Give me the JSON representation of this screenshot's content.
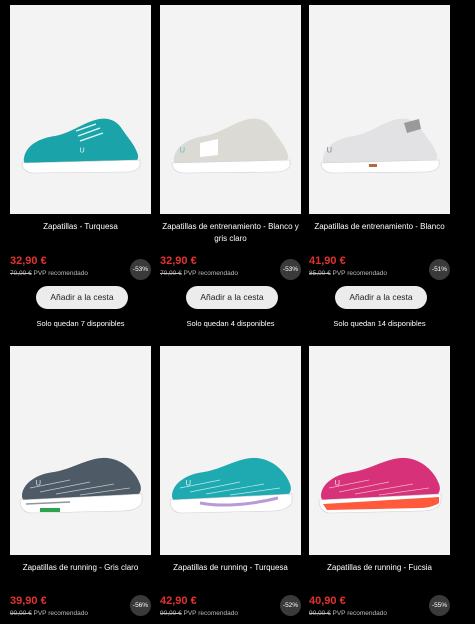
{
  "colors": {
    "background": "#000000",
    "price": "#e4322f",
    "image_bg": "#f3f3f3",
    "button_bg": "#ececec"
  },
  "products": [
    {
      "name": "Zapatillas - Turquesa",
      "price": "32,90 €",
      "old_price": "70,00 €",
      "pvp_label": "PVP recomendado",
      "discount": "-53%",
      "cart_label": "Añadir a la cesta",
      "stock": "Solo quedan 7 disponibles",
      "shoe_color": "#1aa3a8",
      "shoe_style": "trainer"
    },
    {
      "name": "Zapatillas de entrenamiento - Blanco y gris claro",
      "price": "32,90 €",
      "old_price": "70,00 €",
      "pvp_label": "PVP recomendado",
      "discount": "-53%",
      "cart_label": "Añadir a la cesta",
      "stock": "Solo quedan 4 disponibles",
      "shoe_color": "#dcdad5",
      "shoe_style": "trainer"
    },
    {
      "name": "Zapatillas de entrenamiento - Blanco",
      "price": "41,90 €",
      "old_price": "85,00 €",
      "pvp_label": "PVP recomendado",
      "discount": "-51%",
      "cart_label": "Añadir a la cesta",
      "stock": "Solo quedan 14 disponibles",
      "shoe_color": "#e2e2e4",
      "shoe_style": "trainer"
    },
    {
      "name": "Zapatillas de running - Gris claro",
      "price": "39,90 €",
      "old_price": "90,00 €",
      "pvp_label": "PVP recomendado",
      "discount": "-56%",
      "shoe_color": "#4e5a66",
      "shoe_style": "runner"
    },
    {
      "name": "Zapatillas de running - Turquesa",
      "price": "42,90 €",
      "old_price": "90,00 €",
      "pvp_label": "PVP recomendado",
      "discount": "-52%",
      "shoe_color": "#1fa9b0",
      "shoe_style": "runner"
    },
    {
      "name": "Zapatillas de running - Fucsia",
      "price": "40,90 €",
      "old_price": "90,00 €",
      "pvp_label": "PVP recomendado",
      "discount": "-55%",
      "shoe_color": "#d7317a",
      "shoe_style": "runner"
    }
  ]
}
